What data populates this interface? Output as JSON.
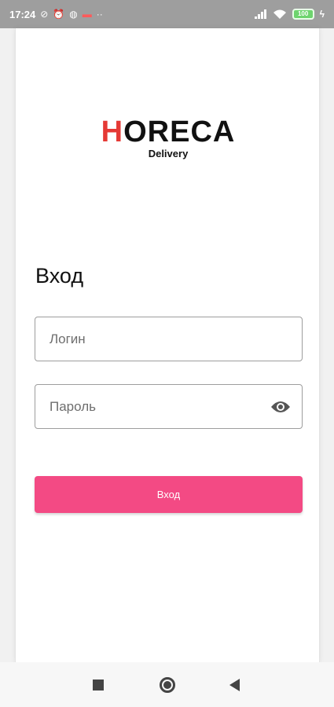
{
  "status_bar": {
    "time": "17:24",
    "left_icons": [
      "sync-off-icon",
      "alarm-icon",
      "vpn-icon",
      "notification-dot-icon",
      "more-dots-icon"
    ],
    "more": "··",
    "battery": "100"
  },
  "logo": {
    "first_letter": "H",
    "rest": "ORECA",
    "subtitle": "Delivery",
    "accent_color": "#e53935"
  },
  "login": {
    "title": "Вход",
    "login_placeholder": "Логин",
    "password_placeholder": "Пароль",
    "submit_label": "Вход",
    "button_color": "#f34a84"
  },
  "nav_bar": {
    "buttons": [
      "recents-square-icon",
      "home-circle-icon",
      "back-triangle-icon"
    ]
  }
}
